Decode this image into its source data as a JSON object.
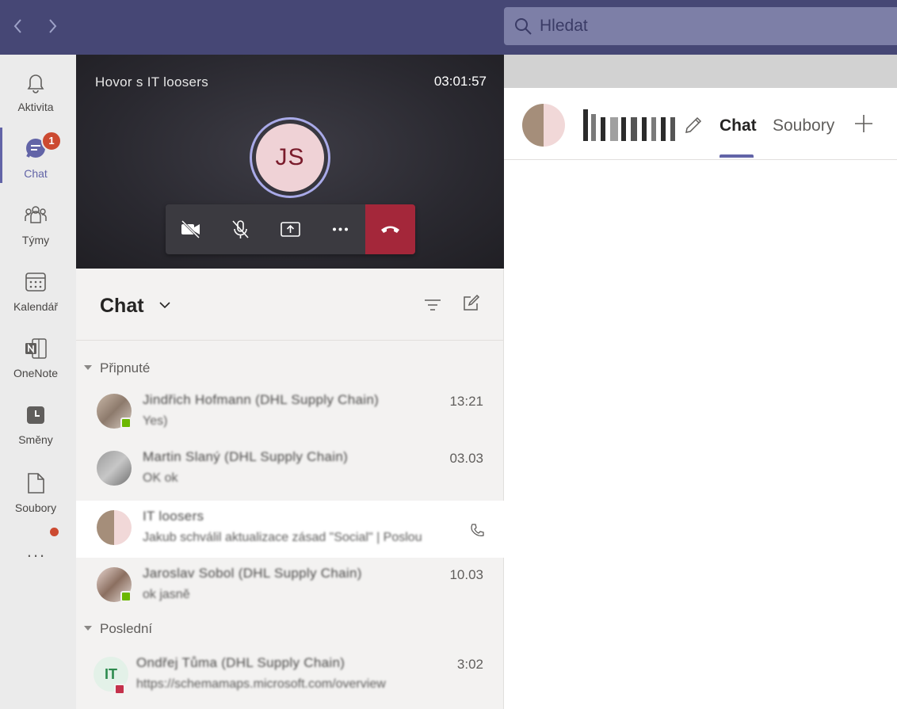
{
  "search": {
    "placeholder": "Hledat"
  },
  "rail": {
    "items": [
      {
        "label": "Aktivita"
      },
      {
        "label": "Chat",
        "badge": "1"
      },
      {
        "label": "Týmy"
      },
      {
        "label": "Kalendář"
      },
      {
        "label": "OneNote"
      },
      {
        "label": "Směny"
      },
      {
        "label": "Soubory"
      }
    ],
    "more": "..."
  },
  "call": {
    "title": "Hovor s IT loosers",
    "timer": "03:01:57",
    "avatar_initials": "JS"
  },
  "chatlist": {
    "title": "Chat",
    "sections": {
      "pinned": "Připnuté",
      "recent": "Poslední"
    },
    "rows": [
      {
        "name": "Jindřich Hofmann (DHL Supply Chain)",
        "preview": "Yes)",
        "time": "13:21"
      },
      {
        "name": "Martin Slaný (DHL Supply Chain)",
        "preview": "OK ok",
        "time": "03.03"
      },
      {
        "name": "IT loosers",
        "preview": "Jakub schválil aktualizace zásad \"Social\" | Poslou",
        "time": ""
      },
      {
        "name": "Jaroslav Sobol (DHL Supply Chain)",
        "preview": "ok jasně",
        "time": "10.03"
      },
      {
        "name": "Ondřej Tůma (DHL Supply Chain)",
        "preview": "https://schemamaps.microsoft.com/overview",
        "time": "3:02",
        "initials": "IT"
      }
    ]
  },
  "right": {
    "tabs": {
      "chat": "Chat",
      "files": "Soubory"
    }
  },
  "colors": {
    "brand": "#6264a7",
    "topbar": "#464775",
    "hangup": "#a4273a",
    "badge": "#cc4a31",
    "available": "#6bb700"
  }
}
